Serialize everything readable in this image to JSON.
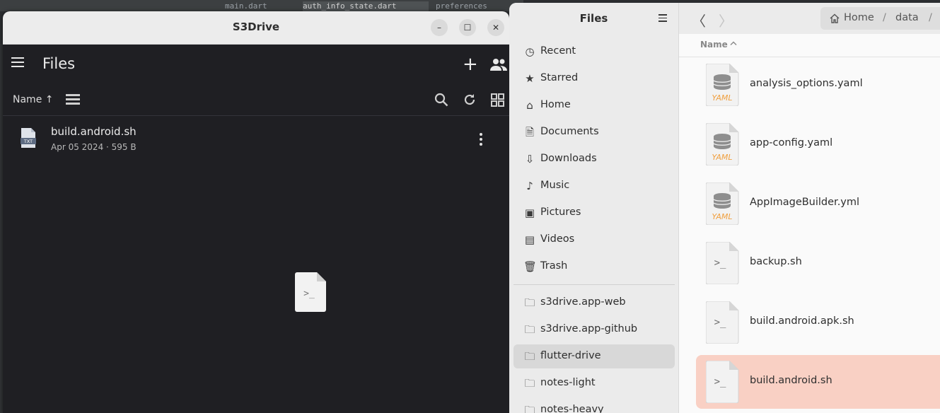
{
  "background_editor": {
    "tabs": [
      "main.dart",
      "auth_info_state.dart",
      "preferences"
    ]
  },
  "s3drive": {
    "window_title": "S3Drive",
    "window_controls": [
      "–",
      "☐",
      "✕"
    ],
    "app_title": "Files",
    "sort_label": "Name ↑",
    "files": [
      {
        "name": "build.android.sh",
        "meta": "Apr 05 2024 · 595 B",
        "icon": "txt-file-icon"
      }
    ],
    "center_preview_icon": "script-file-icon"
  },
  "nautilus": {
    "sidebar_title": "Files",
    "places": [
      {
        "label": "Recent",
        "icon": "clock-icon"
      },
      {
        "label": "Starred",
        "icon": "star-icon"
      },
      {
        "label": "Home",
        "icon": "home-icon"
      },
      {
        "label": "Documents",
        "icon": "document-icon"
      },
      {
        "label": "Downloads",
        "icon": "download-icon"
      },
      {
        "label": "Music",
        "icon": "music-icon"
      },
      {
        "label": "Pictures",
        "icon": "picture-icon"
      },
      {
        "label": "Videos",
        "icon": "video-icon"
      },
      {
        "label": "Trash",
        "icon": "trash-icon"
      }
    ],
    "bookmarks": [
      {
        "label": "s3drive.app-web",
        "icon": "folder-icon",
        "active": false
      },
      {
        "label": "s3drive.app-github",
        "icon": "folder-icon",
        "active": false
      },
      {
        "label": "flutter-drive",
        "icon": "folder-icon",
        "active": true
      },
      {
        "label": "notes-light",
        "icon": "folder-icon",
        "active": false
      },
      {
        "label": "notes-heavy",
        "icon": "folder-icon",
        "active": false
      }
    ],
    "breadcrumb": [
      "Home",
      "data"
    ],
    "column_header": "Name",
    "files": [
      {
        "name": "analysis_options.yaml",
        "type": "yaml",
        "selected": false
      },
      {
        "name": "app-config.yaml",
        "type": "yaml",
        "selected": false
      },
      {
        "name": "AppImageBuilder.yml",
        "type": "yaml",
        "selected": false
      },
      {
        "name": "backup.sh",
        "type": "script",
        "selected": false
      },
      {
        "name": "build.android.apk.sh",
        "type": "script",
        "selected": false
      },
      {
        "name": "build.android.sh",
        "type": "script",
        "selected": true
      }
    ],
    "yaml_badge": "YAML",
    "script_glyph": ">_",
    "txt_badge": "TXT"
  }
}
